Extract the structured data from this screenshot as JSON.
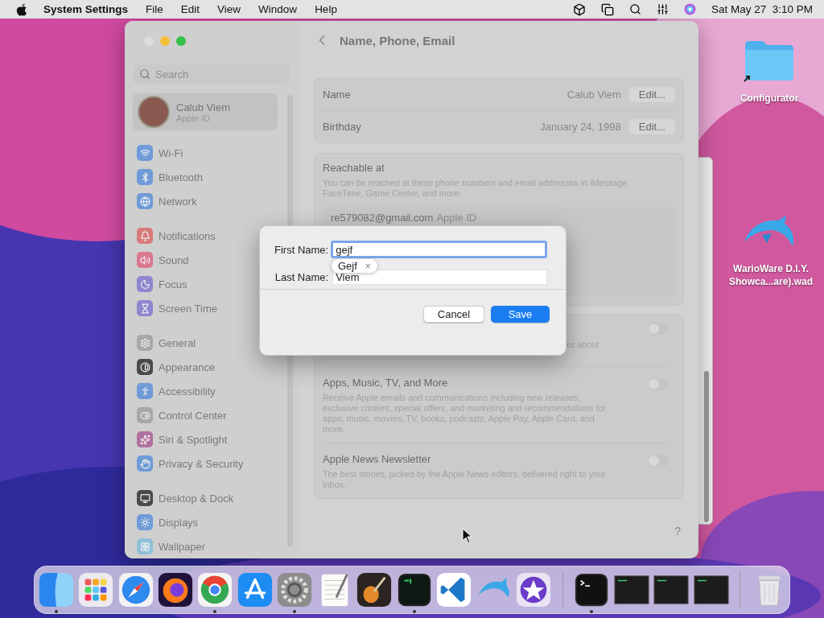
{
  "menu_bar": {
    "app_name": "System Settings",
    "menus": [
      "File",
      "Edit",
      "View",
      "Window",
      "Help"
    ],
    "clock": "Sat May 27  3:10 PM"
  },
  "settings_window": {
    "sidebar": {
      "search": {
        "placeholder": "Search"
      },
      "account": {
        "name": "Calub Viem",
        "subtitle": "Apple ID",
        "selected": true
      },
      "groups": [
        {
          "items": [
            {
              "label": "Wi-Fi",
              "color": "#6f9bd8",
              "selected": false
            },
            {
              "label": "Bluetooth",
              "color": "#6f9bd8",
              "selected": false
            },
            {
              "label": "Network",
              "color": "#6f9bd8",
              "selected": false
            }
          ]
        },
        {
          "items": [
            {
              "label": "Notifications",
              "color": "#d97b7b",
              "selected": false
            },
            {
              "label": "Sound",
              "color": "#d9788f",
              "selected": false
            },
            {
              "label": "Focus",
              "color": "#8e86cf",
              "selected": false
            },
            {
              "label": "Screen Time",
              "color": "#8e86cf",
              "selected": false
            }
          ]
        },
        {
          "items": [
            {
              "label": "General",
              "color": "#a8a8a8",
              "selected": false
            },
            {
              "label": "Appearance",
              "color": "#4a4a4a",
              "selected": false
            },
            {
              "label": "Accessibility",
              "color": "#6f9bd8",
              "selected": false
            },
            {
              "label": "Control Center",
              "color": "#a8a8a8",
              "selected": false
            },
            {
              "label": "Siri & Spotlight",
              "color": "#b070a0",
              "selected": false
            },
            {
              "label": "Privacy & Security",
              "color": "#6f9bd8",
              "selected": false
            }
          ]
        },
        {
          "items": [
            {
              "label": "Desktop & Dock",
              "color": "#4a4a4a",
              "selected": false
            },
            {
              "label": "Displays",
              "color": "#6f9bd8",
              "selected": false
            },
            {
              "label": "Wallpaper",
              "color": "#8fc0d8",
              "selected": false
            }
          ]
        }
      ]
    },
    "title": "Name, Phone, Email",
    "details": [
      {
        "label": "Name",
        "value": "Calub Viem",
        "button": "Edit..."
      },
      {
        "label": "Birthday",
        "value": "January 24, 1998",
        "button": "Edit..."
      }
    ],
    "reachable": {
      "title": "Reachable at",
      "description": "You can be reached at these phone numbers and email addresses in iMessage, FaceTime, Game Center, and more.",
      "email": "re579082@gmail.com",
      "email_tag": "Apple ID"
    },
    "subscriptions": [
      {
        "description": "es about",
        "on": false
      },
      {
        "title": "Apps, Music, TV, and More",
        "description": "Receive Apple emails and communications including new releases, exclusive content, special offers, and marketing and recommendations for apps, music, movies, TV, books, podcasts, Apple Pay, Apple Card, and more.",
        "on": false
      },
      {
        "title": "Apple News Newsletter",
        "description": "The best stories, picked by the Apple News editors, delivered right to your inbox.",
        "on": false
      }
    ],
    "help": "?"
  },
  "dialog": {
    "fields": [
      {
        "label": "First Name:",
        "value": "gejf",
        "focused": true
      },
      {
        "label": "Last Name:",
        "value": "Viem",
        "focused": false
      }
    ],
    "suggestion": {
      "text": "Gejf",
      "close": "×"
    },
    "buttons": [
      {
        "label": "Cancel",
        "kind": "secondary"
      },
      {
        "label": "Save",
        "kind": "primary"
      }
    ]
  },
  "desktop_icons": [
    {
      "label": "Configurator",
      "kind": "folder"
    },
    {
      "label": "WarioWare D.I.Y. Showca...are).wad",
      "kind": "dolphin"
    }
  ],
  "dock": {
    "apps": [
      {
        "kind": "finder",
        "running": true
      },
      {
        "kind": "launchpad",
        "running": false
      },
      {
        "kind": "safari",
        "running": false
      },
      {
        "kind": "firefox",
        "running": false
      },
      {
        "kind": "chrome",
        "running": true
      },
      {
        "kind": "appstore",
        "running": false
      },
      {
        "kind": "settings",
        "running": true
      },
      {
        "kind": "textedit",
        "running": false
      },
      {
        "kind": "garageband",
        "running": false
      },
      {
        "kind": "console",
        "running": true
      },
      {
        "kind": "vscode",
        "running": false
      },
      {
        "kind": "dolphin",
        "running": false
      },
      {
        "kind": "imovie",
        "running": false
      }
    ],
    "recent": [
      {
        "kind": "terminal",
        "running": true
      },
      {
        "kind": "exec",
        "running": false
      },
      {
        "kind": "exec",
        "running": false
      },
      {
        "kind": "exec",
        "running": false
      }
    ],
    "trash": {
      "kind": "trash",
      "running": false
    }
  }
}
